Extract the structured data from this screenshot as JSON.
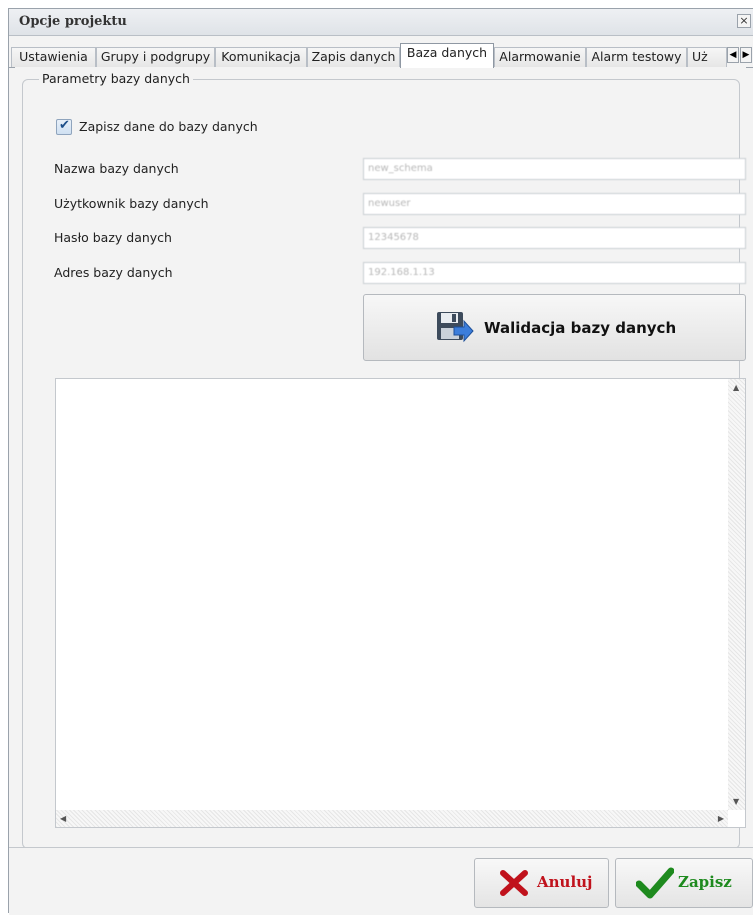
{
  "window": {
    "title": "Opcje projektu",
    "close_glyph": "×"
  },
  "tabs": [
    {
      "label": "Ustawienia"
    },
    {
      "label": "Grupy i podgrupy"
    },
    {
      "label": "Komunikacja"
    },
    {
      "label": "Zapis danych"
    },
    {
      "label": "Baza danych",
      "active": true
    },
    {
      "label": "Alarmowanie"
    },
    {
      "label": "Alarm testowy"
    },
    {
      "label": "Uż"
    }
  ],
  "tab_scroll": {
    "left_glyph": "◀",
    "right_glyph": "▶"
  },
  "group": {
    "legend": "Parametry bazy danych",
    "checkbox": {
      "label": "Zapisz dane do bazy danych",
      "checked": true,
      "mark": "✔"
    },
    "fields": [
      {
        "label": "Nazwa bazy danych",
        "value": "new_schema"
      },
      {
        "label": "Użytkownik bazy danych",
        "value": "newuser"
      },
      {
        "label": "Hasło bazy danych",
        "value": "12345678"
      },
      {
        "label": "Adres bazy danych",
        "value": "192.168.1.13"
      }
    ],
    "validate_button": {
      "label": "Walidacja bazy danych",
      "icon": "floppy-disk-arrow-icon"
    },
    "log_area": {
      "value": ""
    }
  },
  "footer": {
    "cancel": {
      "label": "Anuluj",
      "icon": "red-x-icon",
      "color": "#c0121c"
    },
    "save": {
      "label": "Zapisz",
      "icon": "green-check-icon",
      "color": "#1e8a1e"
    }
  },
  "colors": {
    "window_bg": "#f3f3f3",
    "border": "#9aa2ab"
  }
}
